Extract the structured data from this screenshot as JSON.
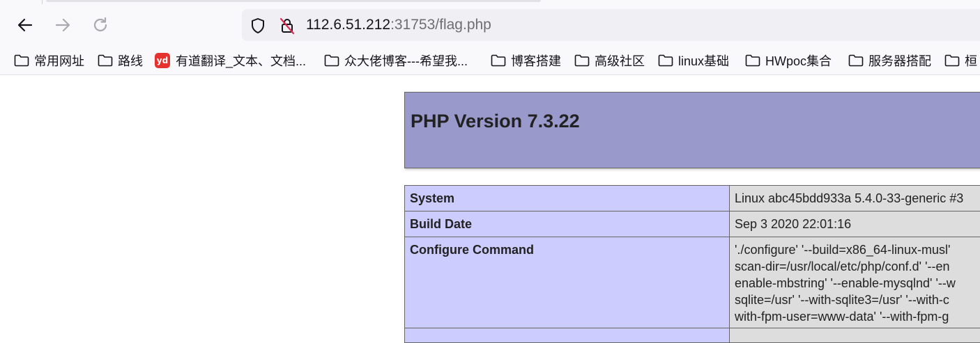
{
  "browser": {
    "url_host": "112.6.51.212",
    "url_rest": ":31753/flag.php",
    "nav": {
      "back_icon": "back-arrow-icon",
      "forward_icon": "forward-arrow-icon",
      "reload_icon": "reload-icon"
    },
    "url_icons": [
      "shield-icon",
      "insecure-lock-icon"
    ],
    "bookmarks": [
      "常用网址",
      "路线",
      "有道翻译_文本、文档...",
      "众大佬博客---希望我...",
      "博客搭建",
      "高级社区",
      "linux基础",
      "HWpoc集合",
      "服务器搭配",
      "桓"
    ],
    "youdao_logo_text": "yd"
  },
  "phpinfo": {
    "title": "PHP Version 7.3.22",
    "rows": [
      {
        "key": "System",
        "value": "Linux abc45bdd933a 5.4.0-33-generic #3"
      },
      {
        "key": "Build Date",
        "value": "Sep 3 2020 22:01:16"
      },
      {
        "key": "Configure Command",
        "lines": [
          "'./configure' '--build=x86_64-linux-musl'",
          "scan-dir=/usr/local/etc/php/conf.d' '--en",
          "enable-mbstring' '--enable-mysqlnd' '--w",
          "sqlite=/usr' '--with-sqlite3=/usr' '--with-c",
          "with-fpm-user=www-data' '--with-fpm-g"
        ]
      }
    ]
  },
  "colors": {
    "header_bg": "#9999cc",
    "key_bg": "#ccccff",
    "value_bg": "#dddddd",
    "chrome_bg": "#f9f9fb",
    "urlbar_bg": "#f0f0f4",
    "youdao_red": "#e7312f"
  }
}
